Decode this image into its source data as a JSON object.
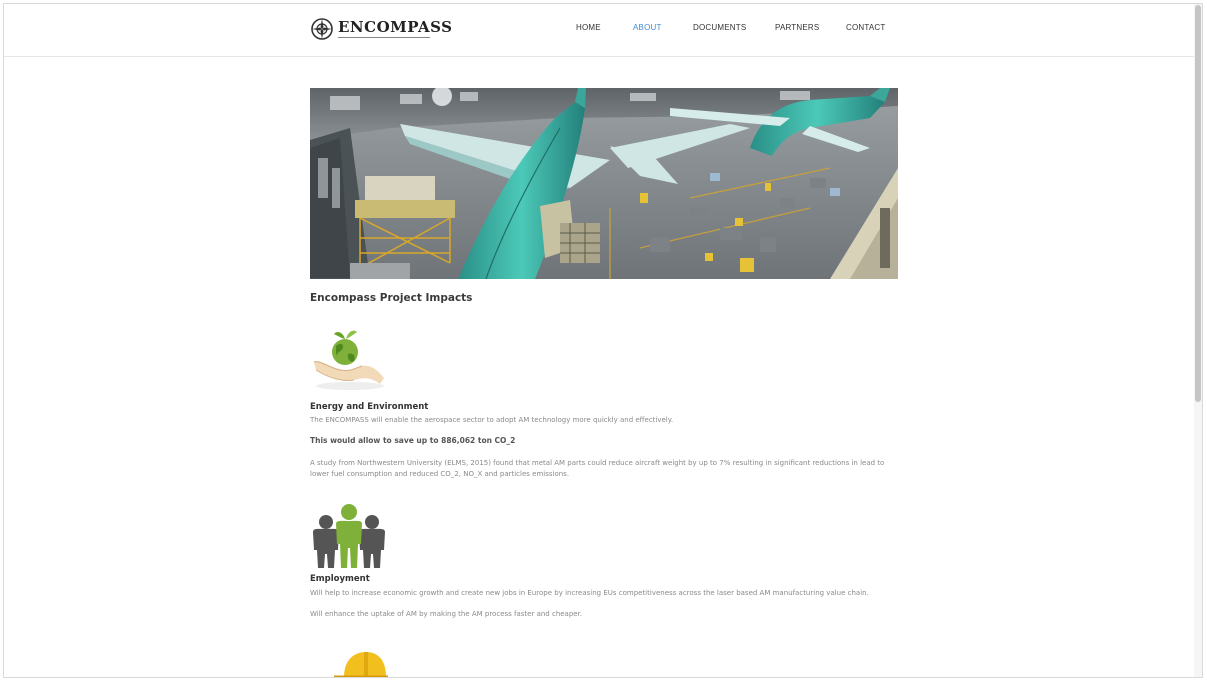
{
  "header": {
    "logo_text": "ENCOMPASS",
    "nav": [
      {
        "label": "HOME",
        "active": false
      },
      {
        "label": "ABOUT",
        "active": true
      },
      {
        "label": "DOCUMENTS",
        "active": false
      },
      {
        "label": "PARTNERS",
        "active": false
      },
      {
        "label": "CONTACT",
        "active": false
      }
    ]
  },
  "main": {
    "section_title": "Encompass Project Impacts",
    "energy": {
      "title": "Energy and Environment",
      "text1": "The ENCOMPASS will enable the aerospace sector to adopt AM technology more quickly and effectively.",
      "highlight": "This would allow to save up to 886,062 ton CO_2",
      "text2": "A study from Northwestern University (ELMS, 2015) found that metal AM parts could reduce aircraft weight by up to 7% resulting in significant reductions in lead to lower fuel consumption and reduced CO_2, NO_X and particles emissions."
    },
    "employment": {
      "title": "Employment",
      "text1": "Will help to increase economic growth and create new jobs in Europe by increasing EUs competitiveness across the laser based AM manufacturing value chain.",
      "text2": "Will enhance the uptake of AM by making the AM process faster and cheaper."
    }
  },
  "colors": {
    "accent": "#3f8bd6",
    "green": "#7fb13a",
    "gray_icon": "#555555",
    "aircraft_teal": "#3bb5a6"
  }
}
